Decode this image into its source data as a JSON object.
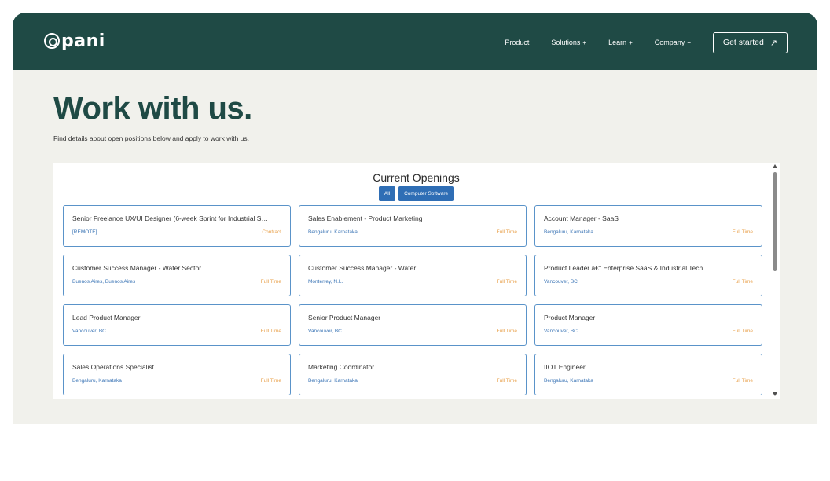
{
  "brand": {
    "name": "pani",
    "icon": "pani-logo-icon"
  },
  "nav": {
    "items": [
      {
        "label": "Product",
        "has_dropdown": false
      },
      {
        "label": "Solutions",
        "has_dropdown": true,
        "suffix": "+"
      },
      {
        "label": "Learn",
        "has_dropdown": true,
        "suffix": "+"
      },
      {
        "label": "Company",
        "has_dropdown": true,
        "suffix": "+"
      }
    ],
    "cta_label": "Get started",
    "cta_icon": "arrow-up-right-icon",
    "cta_arrow": "↗"
  },
  "hero": {
    "title": "Work with us.",
    "subtitle": "Find details about open positions below and apply to work with us."
  },
  "openings": {
    "title": "Current Openings",
    "filters": [
      "All",
      "Computer Software"
    ],
    "jobs": [
      {
        "title": "Senior Freelance UX/UI Designer (6-week Sprint for Industrial S…",
        "location": "[REMOTE]",
        "type": "Contract"
      },
      {
        "title": "Sales Enablement - Product Marketing",
        "location": "Bengaluru, Karnataka",
        "type": "Full Time"
      },
      {
        "title": "Account Manager - SaaS",
        "location": "Bengaluru, Karnataka",
        "type": "Full Time"
      },
      {
        "title": "Customer Success Manager - Water Sector",
        "location": "Buenos Aires, Buenos Aires",
        "type": "Full Time"
      },
      {
        "title": "Customer Success Manager - Water",
        "location": "Monterrey, N.L.",
        "type": "Full Time"
      },
      {
        "title": "Product Leader â€\" Enterprise SaaS & Industrial Tech",
        "location": "Vancouver, BC",
        "type": "Full Time"
      },
      {
        "title": "Lead Product Manager",
        "location": "Vancouver, BC",
        "type": "Full Time"
      },
      {
        "title": "Senior Product Manager",
        "location": "Vancouver, BC",
        "type": "Full Time"
      },
      {
        "title": "Product Manager",
        "location": "Vancouver, BC",
        "type": "Full Time"
      },
      {
        "title": "Sales Operations Specialist",
        "location": "Bengaluru, Karnataka",
        "type": "Full Time"
      },
      {
        "title": "Marketing Coordinator",
        "location": "Bengaluru, Karnataka",
        "type": "Full Time"
      },
      {
        "title": "IIOT Engineer",
        "location": "Bengaluru, Karnataka",
        "type": "Full Time"
      }
    ]
  },
  "colors": {
    "nav_bg": "#1f4a45",
    "page_bg": "#f1f1ec",
    "accent_blue": "#2f6eb5",
    "type_orange": "#e8a04a"
  }
}
